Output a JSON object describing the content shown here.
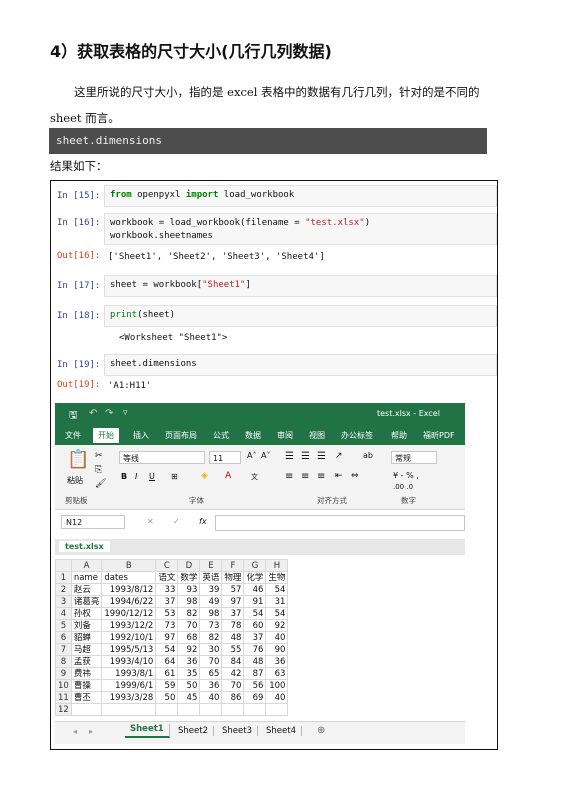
{
  "heading": "4）获取表格的尺寸大小(几行几列数据)",
  "paragraph1": "这里所说的尺寸大小，指的是 excel 表格中的数据有几行几列，针对的是不同的",
  "paragraph2": "sheet 而言。",
  "code_bar": "sheet.dimensions",
  "result_label": "结果如下：",
  "notebook": {
    "cells": [
      {
        "prompt": "In  [15]:",
        "code_kw1": "from",
        "code_mid": " openpyxl ",
        "code_kw2": "import",
        "code_end": " load_workbook"
      },
      {
        "prompt": "In  [16]:",
        "line1_a": "workbook = load_workbook(filename = ",
        "line1_str": "\"test.xlsx\"",
        "line1_b": ")",
        "line2": "workbook.sheetnames"
      },
      {
        "prompt": "Out[16]:",
        "text": "['Sheet1', 'Sheet2', 'Sheet3', 'Sheet4']"
      },
      {
        "prompt": "In  [17]:",
        "code_a": "sheet = workbook[",
        "code_str": "\"Sheet1\"",
        "code_b": "]"
      },
      {
        "prompt": "In  [18]:",
        "code_fn": "print",
        "code_rest": "(sheet)"
      },
      {
        "text": "<Worksheet \"Sheet1\">"
      },
      {
        "prompt": "In  [19]:",
        "code": "sheet.dimensions"
      },
      {
        "prompt": "Out[19]:",
        "text": "'A1:H11'"
      }
    ]
  },
  "excel": {
    "title": "test.xlsx  -  Excel",
    "tabs": [
      "文件",
      "开始",
      "插入",
      "页面布局",
      "公式",
      "数据",
      "审阅",
      "视图",
      "办公标签",
      "帮助",
      "福昕PDF"
    ],
    "font_name": "等线",
    "font_size": "11",
    "number_format": "常规",
    "groups": [
      "剪贴板",
      "字体",
      "对齐方式",
      "数字"
    ],
    "paste_label": "粘贴",
    "name_box": "N12",
    "fx": "fx",
    "file_tab": "test.xlsx",
    "columns": [
      "A",
      "B",
      "C",
      "D",
      "E",
      "F",
      "G",
      "H"
    ],
    "rows": [
      [
        "name",
        "dates",
        "语文",
        "数学",
        "英语",
        "物理",
        "化学",
        "生物"
      ],
      [
        "赵云",
        "1993/8/12",
        "33",
        "93",
        "39",
        "57",
        "46",
        "54"
      ],
      [
        "诸葛亮",
        "1994/6/22",
        "37",
        "98",
        "49",
        "97",
        "91",
        "31"
      ],
      [
        "孙权",
        "1990/12/12",
        "53",
        "82",
        "98",
        "37",
        "54",
        "54"
      ],
      [
        "刘备",
        "1993/12/2",
        "73",
        "70",
        "73",
        "78",
        "60",
        "92"
      ],
      [
        "貂蝉",
        "1992/10/1",
        "97",
        "68",
        "82",
        "48",
        "37",
        "40"
      ],
      [
        "马超",
        "1995/5/13",
        "54",
        "92",
        "30",
        "55",
        "76",
        "90"
      ],
      [
        "孟获",
        "1993/4/10",
        "64",
        "36",
        "70",
        "84",
        "48",
        "36"
      ],
      [
        "费祎",
        "1993/8/1",
        "61",
        "35",
        "65",
        "42",
        "87",
        "63"
      ],
      [
        "曹操",
        "1999/6/1",
        "59",
        "50",
        "36",
        "70",
        "56",
        "100"
      ],
      [
        "曹丕",
        "1993/3/28",
        "50",
        "45",
        "40",
        "86",
        "69",
        "40"
      ],
      [
        "",
        "",
        "",
        "",
        "",
        "",
        "",
        ""
      ]
    ],
    "sheets": [
      "Sheet1",
      "Sheet2",
      "Sheet3",
      "Sheet4"
    ],
    "accent": "#217346"
  }
}
